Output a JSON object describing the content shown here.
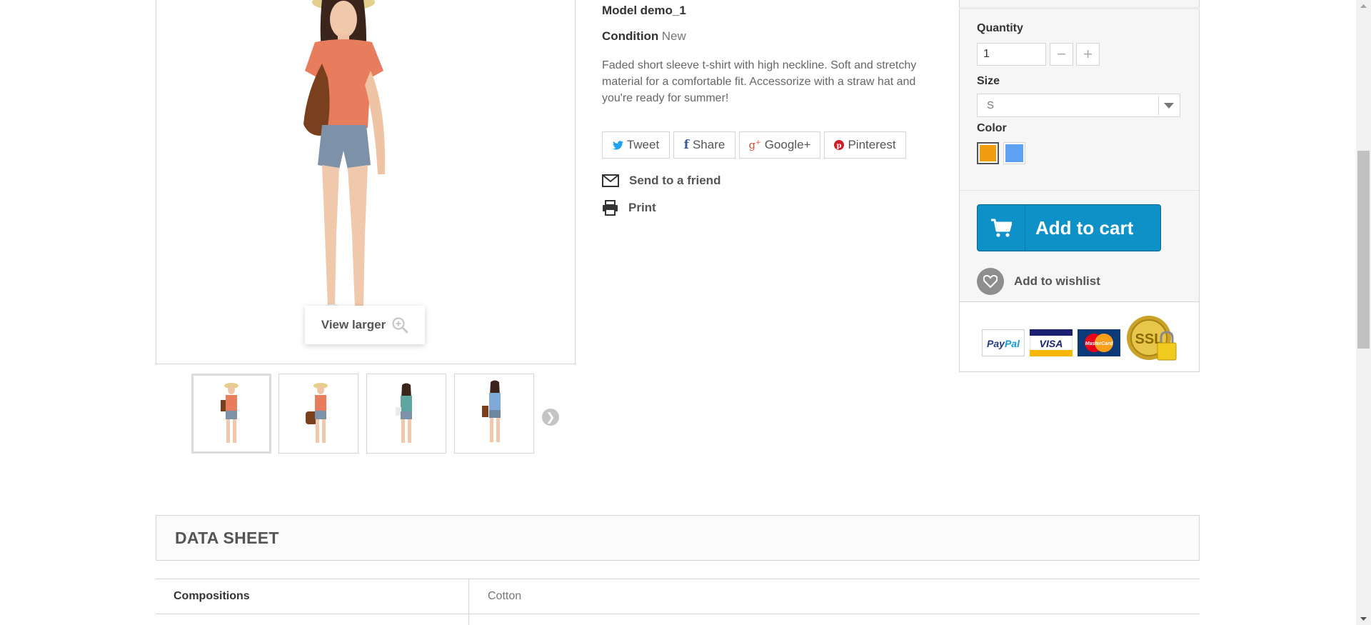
{
  "product": {
    "model_label": "Model",
    "model_value": "demo_1",
    "condition_label": "Condition",
    "condition_value": "New",
    "description": "Faded short sleeve t-shirt with high neckline. Soft and stretchy material for a comfortable fit. Accessorize with a straw hat and you're ready for summer!"
  },
  "gallery": {
    "view_larger": "View larger",
    "thumbnail_count": 4
  },
  "social": {
    "tweet": "Tweet",
    "share": "Share",
    "google": "Google+",
    "pinterest": "Pinterest",
    "brand_colors": {
      "twitter": "#1da1f2",
      "facebook": "#3b5998",
      "google": "#dd4b39",
      "pinterest": "#cb2027"
    }
  },
  "actions": {
    "send_to_friend": "Send to a friend",
    "print": "Print"
  },
  "buy_box": {
    "quantity_label": "Quantity",
    "quantity_value": "1",
    "size_label": "Size",
    "size_value": "S",
    "color_label": "Color",
    "colors": [
      {
        "name": "Orange",
        "hex": "#f39c11",
        "selected": true
      },
      {
        "name": "Blue",
        "hex": "#5ea1f2",
        "selected": false
      }
    ],
    "add_to_cart": "Add to cart",
    "add_to_wishlist": "Add to wishlist",
    "payment_logos": [
      "PayPal",
      "VISA",
      "MasterCard",
      "SSL"
    ]
  },
  "data_sheet": {
    "title": "DATA SHEET",
    "rows": [
      {
        "key": "Compositions",
        "value": "Cotton"
      }
    ]
  },
  "colors": {
    "accent_blue": "#0e91c7",
    "border": "#d6d4d4",
    "panel_grey": "#f6f6f6"
  }
}
